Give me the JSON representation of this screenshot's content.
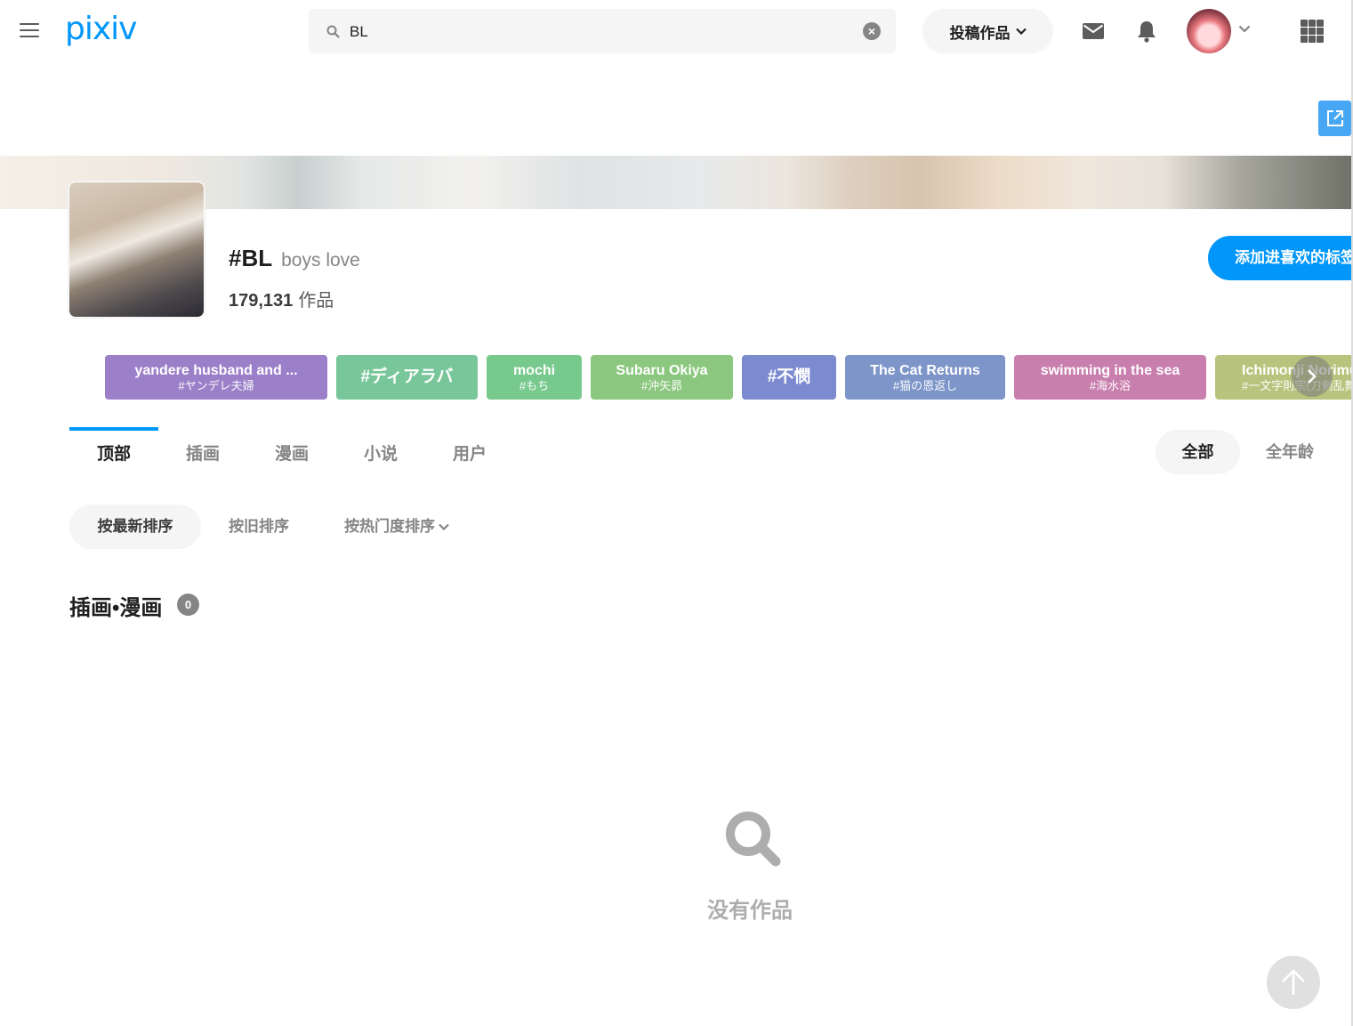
{
  "header": {
    "logo": "pixiv",
    "search": {
      "value": "BL",
      "placeholder": ""
    },
    "post_label": "投稿作品"
  },
  "tag": {
    "hash": "#BL",
    "translation": "boys love",
    "count_number": "179,131",
    "count_unit": "作品",
    "fav_button": "添加进喜欢的标签"
  },
  "related_tags": [
    {
      "name": "yandere husband and ...",
      "sub": "#ヤンデレ夫婦",
      "color": "#9b7fc8"
    },
    {
      "name": "#ディアラバ",
      "sub": "",
      "color": "#78c69a"
    },
    {
      "name": "mochi",
      "sub": "#もち",
      "color": "#78c98d"
    },
    {
      "name": "Subaru Okiya",
      "sub": "#沖矢昴",
      "color": "#8cc77f"
    },
    {
      "name": "#不憫",
      "sub": "",
      "color": "#7c8ad0"
    },
    {
      "name": "The Cat Returns",
      "sub": "#猫の恩返し",
      "color": "#7e95c9"
    },
    {
      "name": "swimming in the sea",
      "sub": "#海水浴",
      "color": "#c97fae"
    },
    {
      "name": "Ichimonji Norimune",
      "sub": "#一文字則宗(刀剣乱舞)",
      "color": "#b8c47e"
    }
  ],
  "tabs": [
    {
      "label": "顶部",
      "active": true
    },
    {
      "label": "插画",
      "active": false
    },
    {
      "label": "漫画",
      "active": false
    },
    {
      "label": "小说",
      "active": false
    },
    {
      "label": "用户",
      "active": false
    }
  ],
  "age_filter": {
    "all": "全部",
    "safe": "全年龄"
  },
  "sort": {
    "newest": "按最新排序",
    "oldest": "按旧排序",
    "popular": "按热门度排序"
  },
  "section": {
    "title": "插画•漫画",
    "count": "0",
    "empty_text": "没有作品"
  },
  "icons": {
    "menu": "hamburger-icon",
    "search": "search-icon",
    "clear": "clear-icon",
    "mail": "mail-icon",
    "bell": "bell-icon",
    "apps": "grid-icon",
    "external": "external-link-icon",
    "next": "chevron-right-icon",
    "top": "arrow-up-icon"
  },
  "colors": {
    "accent": "#0096fa"
  }
}
